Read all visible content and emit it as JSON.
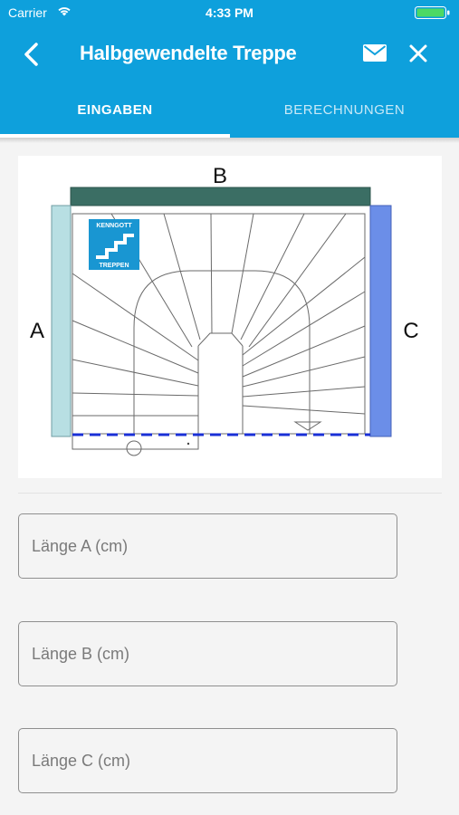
{
  "status": {
    "carrier": "Carrier",
    "time": "4:33 PM"
  },
  "nav": {
    "title": "Halbgewendelte Treppe"
  },
  "tabs": [
    {
      "label": "EINGABEN",
      "active": true
    },
    {
      "label": "BERECHNUNGEN",
      "active": false
    }
  ],
  "diagram": {
    "labels": {
      "a": "A",
      "b": "B",
      "c": "C"
    },
    "logo": {
      "line1": "KENNGOTT",
      "line2": "TREPPEN"
    }
  },
  "fields": [
    {
      "placeholder": "Länge A (cm)",
      "value": ""
    },
    {
      "placeholder": "Länge B (cm)",
      "value": ""
    },
    {
      "placeholder": "Länge C (cm)",
      "value": ""
    }
  ],
  "colors": {
    "header": "#0ea0dc",
    "side_a": "#b8dfe3",
    "side_b": "#3b6e64",
    "side_c": "#6b8ee8",
    "dashed_line": "#1a2fd6"
  }
}
